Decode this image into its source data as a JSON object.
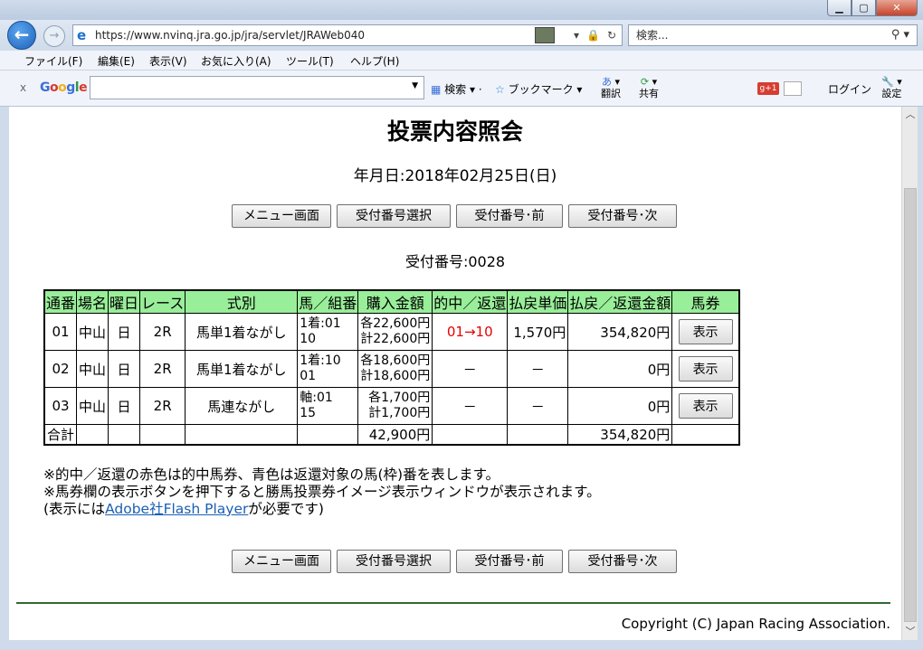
{
  "browser": {
    "url": "https://www.nvinq.jra.go.jp/jra/servlet/JRAWeb040",
    "search_placeholder": "検索...",
    "menu": [
      "ファイル(F)",
      "編集(E)",
      "表示(V)",
      "お気に入り(A)",
      "ツール(T)",
      "ヘルプ(H)"
    ],
    "google": {
      "close": "x",
      "logo": "Google",
      "search_label": "検索",
      "bookmark_label": "ブックマーク",
      "translate_label": "翻訳",
      "share_label": "共有",
      "gplus": "g+1",
      "login_label": "ログイン",
      "settings_label": "設定"
    }
  },
  "page": {
    "title": "投票内容照会",
    "date_line": "年月日:2018年02月25日(日)",
    "buttons": {
      "menu": "メニュー画面",
      "select": "受付番号選択",
      "prev": "受付番号･前",
      "next": "受付番号･次"
    },
    "receipt_line": "受付番号:0028",
    "table": {
      "headers": [
        "通番",
        "場名",
        "曜日",
        "レース",
        "式別",
        "馬／組番",
        "購入金額",
        "的中／返還",
        "払戻単価",
        "払戻／返還金額",
        "馬券"
      ],
      "rows": [
        {
          "no": "01",
          "venue": "中山",
          "day": "日",
          "race": "2R",
          "type": "馬単1着ながし",
          "combo1": "1着:01",
          "combo2": "10",
          "amount1": "各22,600円",
          "amount2": "計22,600円",
          "hit": "01→10",
          "unit": "1,570円",
          "payout": "354,820円",
          "ticket": "表示"
        },
        {
          "no": "02",
          "venue": "中山",
          "day": "日",
          "race": "2R",
          "type": "馬単1着ながし",
          "combo1": "1着:10",
          "combo2": "01",
          "amount1": "各18,600円",
          "amount2": "計18,600円",
          "hit": "－",
          "unit": "－",
          "payout": "0円",
          "ticket": "表示"
        },
        {
          "no": "03",
          "venue": "中山",
          "day": "日",
          "race": "2R",
          "type": "馬連ながし",
          "combo1": "軸:01",
          "combo2": "15",
          "amount1": "各1,700円",
          "amount2": "計1,700円",
          "hit": "－",
          "unit": "－",
          "payout": "0円",
          "ticket": "表示"
        }
      ],
      "total": {
        "label": "合計",
        "amount": "42,900円",
        "payout": "354,820円"
      }
    },
    "notes": {
      "line1": "※的中／返還の赤色は的中馬券、青色は返還対象の馬(枠)番を表します。",
      "line2": "※馬券欄の表示ボタンを押下すると勝馬投票券イメージ表示ウィンドウが表示されます。",
      "line3_pre": "(表示には",
      "line3_link": "Adobe社Flash Player",
      "line3_post": "が必要です)"
    },
    "copyright": "Copyright (C) Japan Racing Association."
  }
}
